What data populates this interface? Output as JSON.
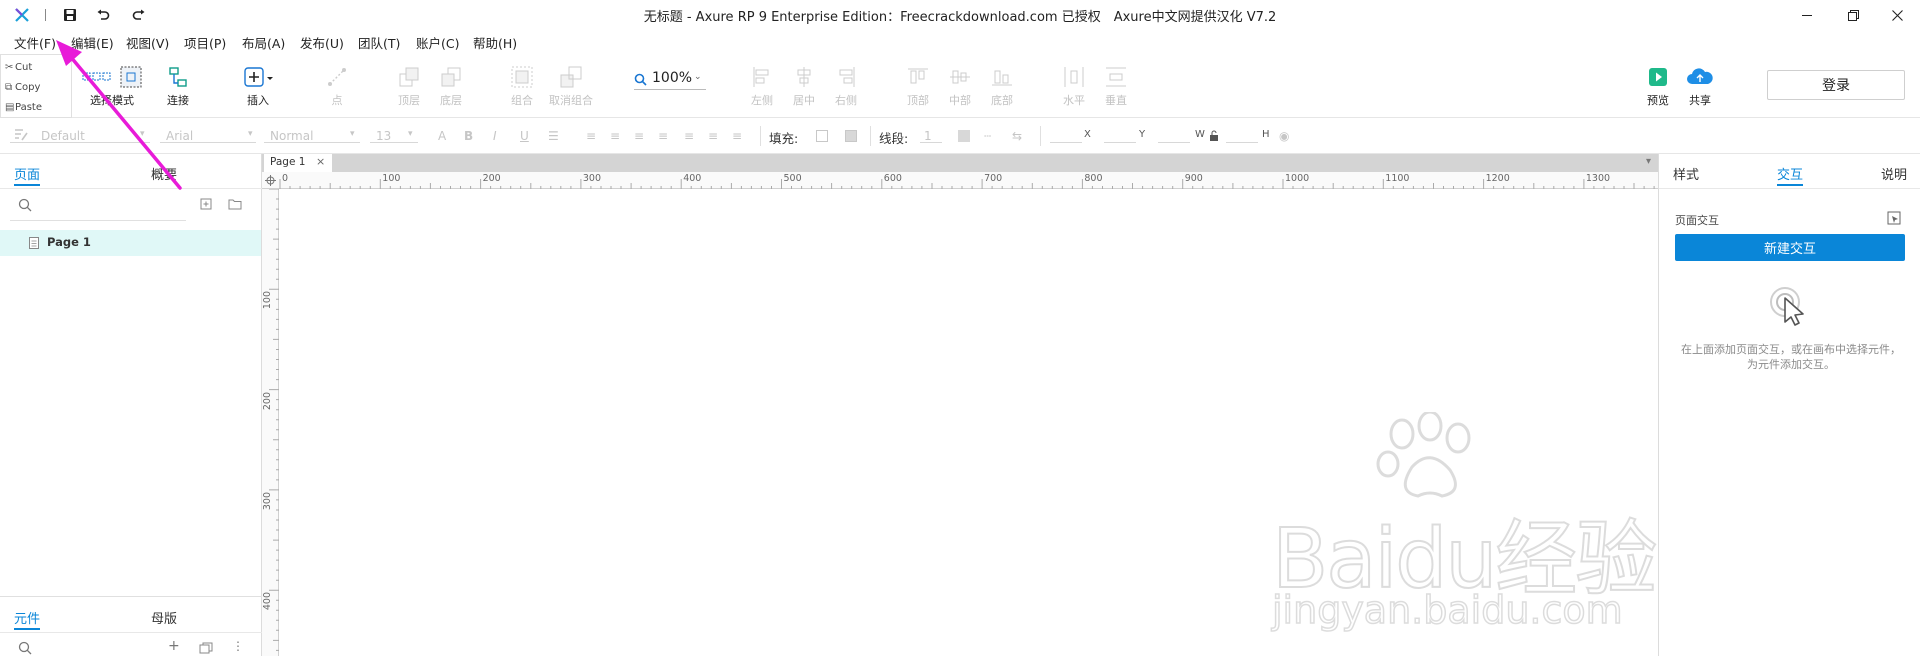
{
  "window": {
    "title": "无标题 - Axure RP 9 Enterprise Edition：Freecrackdownload.com 已授权　Axure中文网提供汉化 V7.2"
  },
  "menubar": [
    "文件(F)",
    "编辑(E)",
    "视图(V)",
    "项目(P)",
    "布局(A)",
    "发布(U)",
    "团队(T)",
    "账户(C)",
    "帮助(H)"
  ],
  "context_menu": [
    "Cut",
    "Copy",
    "Paste"
  ],
  "toolbar": {
    "select_mode": "选择模式",
    "connect": "连接",
    "insert": "插入",
    "point": "点",
    "top_layer": "顶层",
    "bottom_layer": "底层",
    "group": "组合",
    "ungroup": "取消组合",
    "zoom": "100%",
    "align_left": "左侧",
    "align_center": "居中",
    "align_right": "右侧",
    "align_top": "顶部",
    "align_middle": "中部",
    "align_bottom": "底部",
    "dist_horizontal": "水平",
    "dist_vertical": "垂直",
    "preview": "预览",
    "share": "共享",
    "login": "登录"
  },
  "stylebar": {
    "style_default": "Default",
    "font": "Arial",
    "weight": "Normal",
    "size": "13",
    "fill_label": "填充:",
    "line_label": "线段:",
    "line_width": "1",
    "x_label": "X",
    "y_label": "Y",
    "w_label": "W",
    "h_label": "H"
  },
  "left_panel": {
    "tab_pages": "页面",
    "tab_outline": "概要",
    "pages": [
      "Page 1"
    ],
    "tab_widgets": "元件",
    "tab_masters": "母版"
  },
  "canvas": {
    "tab": "Page 1",
    "ruler_h": [
      "0",
      "100",
      "200",
      "300",
      "400",
      "500",
      "600",
      "700",
      "800",
      "900",
      "1000",
      "1100",
      "1200",
      "1300"
    ],
    "ruler_v": [
      "100",
      "200",
      "300",
      "400"
    ]
  },
  "right_panel": {
    "tab_style": "样式",
    "tab_interaction": "交互",
    "tab_notes": "说明",
    "page_interaction": "页面交互",
    "new_interaction": "新建交互",
    "hint": "在上面添加页面交互，或在画布中选择元件，为元件添加交互。"
  },
  "watermark": {
    "text": "Baidu经验",
    "url_text": "jingyan.baidu.com"
  },
  "colors": {
    "accent": "#0a86d8",
    "preview_green": "#1fb98a",
    "share_blue": "#1e8ee6",
    "arrow": "#e81bd8"
  }
}
